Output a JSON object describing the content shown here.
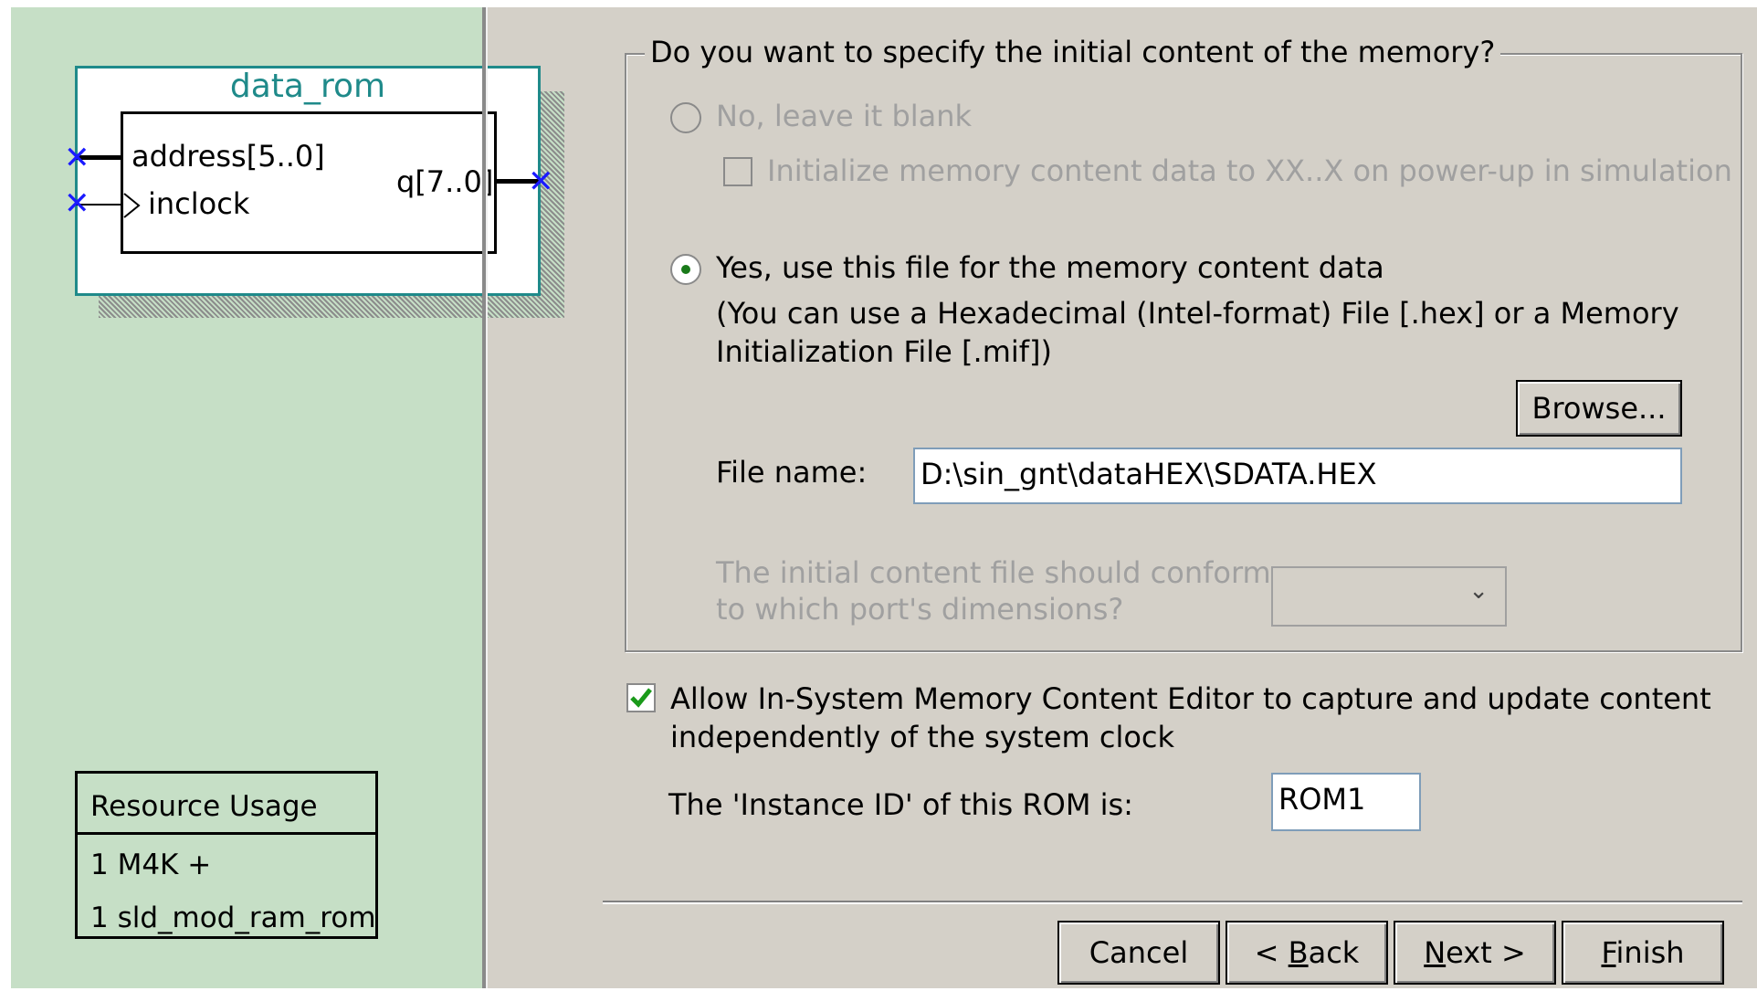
{
  "symbol": {
    "title": "data_rom",
    "ports": {
      "address": "address[5..0]",
      "inclock": "inclock",
      "q": "q[7..0]"
    }
  },
  "resource_usage": {
    "header": "Resource Usage",
    "rows": [
      "1 M4K +",
      "1 sld_mod_ram_rom"
    ]
  },
  "init_group": {
    "legend": "Do you want to specify the initial content of the memory?",
    "option_blank": "No, leave it blank",
    "init_checkbox": "Initialize memory content data to XX..X on power-up in simulation",
    "option_file": "Yes, use this file for the memory content data",
    "hint_line1": "(You can use a Hexadecimal (Intel-format) File [.hex] or a Memory",
    "hint_line2": "Initialization File [.mif])",
    "browse_label": "Browse...",
    "file_name_label": "File name:",
    "file_name_value": "D:\\sin_gnt\\dataHEX\\SDATA.HEX",
    "conform_line1": "The initial content file should conform",
    "conform_line2": "to which port's dimensions?",
    "conform_selected": ""
  },
  "editor": {
    "allow_line1": "Allow In-System Memory Content Editor to capture and update content",
    "allow_line2": "independently of the system clock",
    "allow_checked": true,
    "instance_label": "The 'Instance ID' of this ROM is:",
    "instance_value": "ROM1"
  },
  "buttons": {
    "cancel": "Cancel",
    "back_prefix": "< ",
    "back_mnemonic": "B",
    "back_rest": "ack",
    "next_mnemonic": "N",
    "next_rest": "ext >",
    "finish_mnemonic": "F",
    "finish_rest": "inish"
  },
  "colors": {
    "left_panel": "#c6dfc6",
    "symbol_accent": "#1f8a8a",
    "check_green": "#1a9a1a"
  }
}
